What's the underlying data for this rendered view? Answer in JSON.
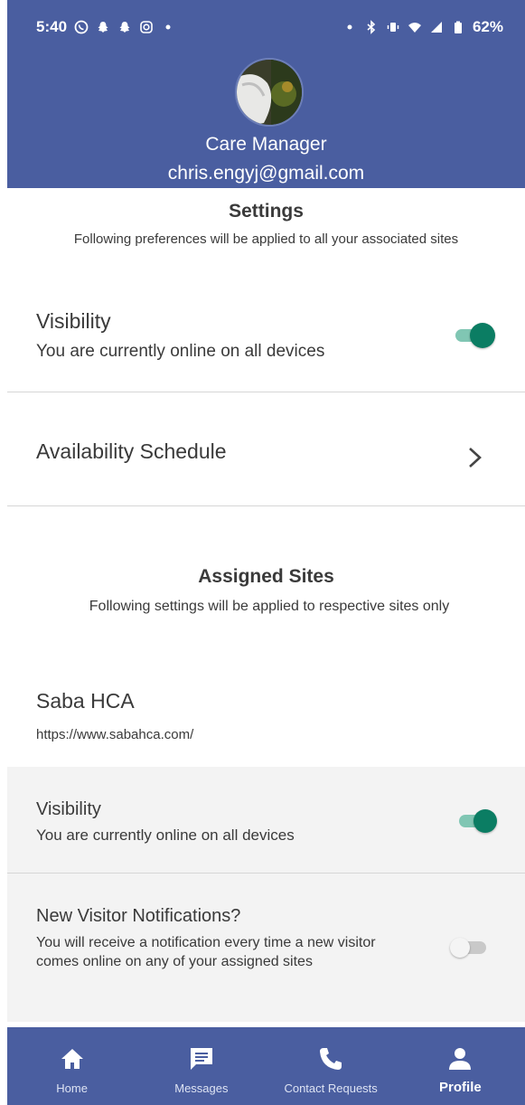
{
  "status_bar": {
    "time": "5:40",
    "battery": "62%"
  },
  "header": {
    "role": "Care Manager",
    "email": "chris.engyj@gmail.com"
  },
  "settings": {
    "title": "Settings",
    "subtitle": "Following preferences will be applied to all your associated sites",
    "visibility": {
      "label": "Visibility",
      "description": "You are currently online on all devices",
      "enabled": true
    },
    "availability": {
      "label": "Availability Schedule"
    }
  },
  "assigned_sites": {
    "title": "Assigned Sites",
    "subtitle": "Following settings will be applied to respective sites only",
    "site": {
      "name": "Saba HCA",
      "url": "https://www.sabahca.com/",
      "visibility": {
        "label": "Visibility",
        "description": "You are currently online on all devices",
        "enabled": true
      },
      "notifications": {
        "label": "New Visitor Notifications?",
        "description": "You will receive a notification every time a new visitor comes online on any of your assigned sites",
        "enabled": false
      }
    }
  },
  "bottom_nav": {
    "items": [
      {
        "label": "Home",
        "icon": "home-icon"
      },
      {
        "label": "Messages",
        "icon": "messages-icon"
      },
      {
        "label": "Contact Requests",
        "icon": "phone-icon"
      },
      {
        "label": "Profile",
        "icon": "profile-icon"
      }
    ],
    "active": "Profile"
  },
  "colors": {
    "brand": "#4a5ea0",
    "toggle_on": "#0b7d63",
    "toggle_track_on": "#80c6b3",
    "panel_bg": "#f3f3f3"
  }
}
